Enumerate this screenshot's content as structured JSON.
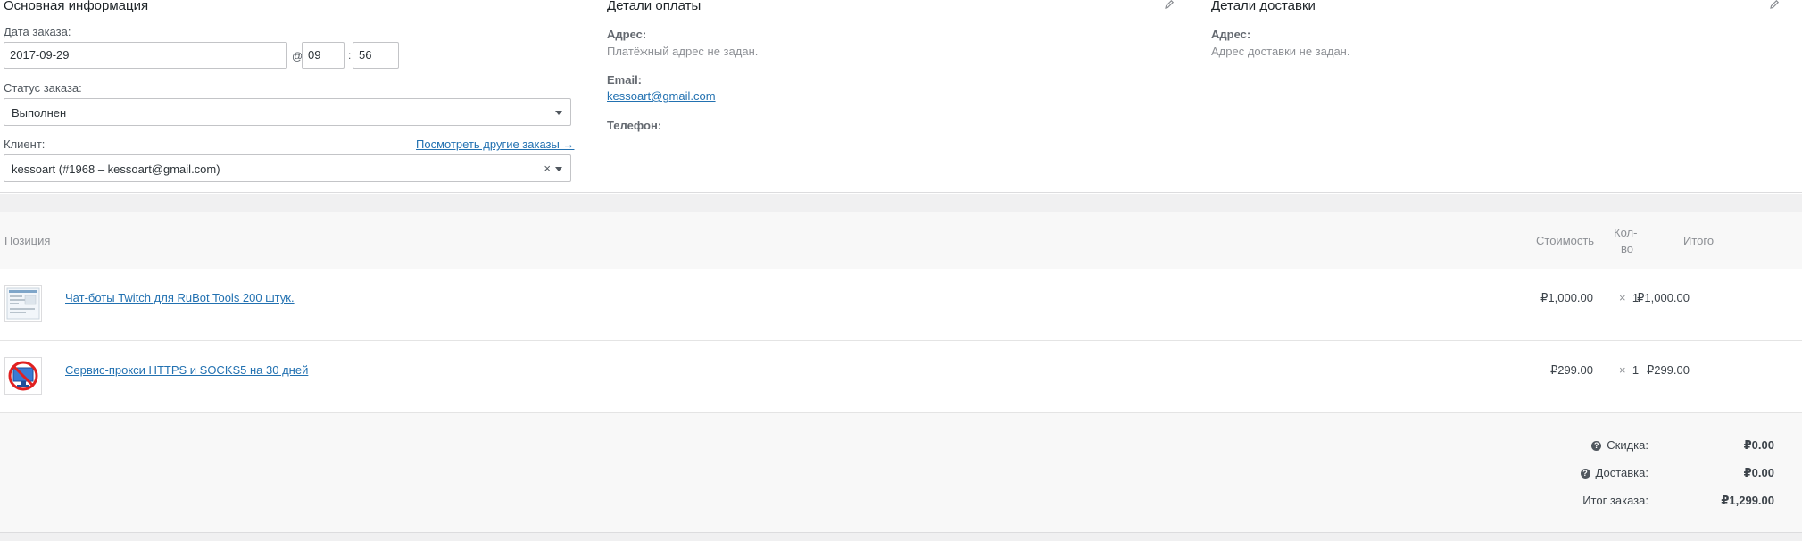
{
  "general": {
    "title": "Основная информация",
    "date_label": "Дата заказа:",
    "date_value": "2017-09-29",
    "at": "@",
    "hour": "09",
    "colon": ":",
    "minute": "56",
    "status_label": "Статус заказа:",
    "status_value": "Выполнен",
    "customer_label": "Клиент:",
    "other_orders_link": "Посмотреть другие заказы →",
    "customer_value": "kessoart (#1968 – kessoart@gmail.com)",
    "clear_icon": "×"
  },
  "billing": {
    "title": "Детали оплаты",
    "address_label": "Адрес:",
    "address_value": "Платёжный адрес не задан.",
    "email_label": "Email:",
    "email_value": "kessoart@gmail.com",
    "phone_label": "Телефон:"
  },
  "shipping": {
    "title": "Детали доставки",
    "address_label": "Адрес:",
    "address_value": "Адрес доставки не задан."
  },
  "table": {
    "col_item": "Позиция",
    "col_cost": "Стоимость",
    "col_qty_1": "Кол-",
    "col_qty_2": "во",
    "col_total": "Итого",
    "rows": [
      {
        "name": "Чат-боты Twitch для RuBot Tools 200 штук.",
        "cost": "₽1,000.00",
        "times": "×",
        "qty": "1",
        "total": "₽1,000.00",
        "thumb": "screenshot-thumbnail"
      },
      {
        "name": "Сервис-прокси HTTPS и SOCKS5 на 30 дней",
        "cost": "₽299.00",
        "times": "×",
        "qty": "1",
        "total": "₽299.00",
        "thumb": "no-monitor-icon"
      }
    ]
  },
  "totals": {
    "discount_label": "Скидка:",
    "discount_value": "₽0.00",
    "shipping_label": "Доставка:",
    "shipping_value": "₽0.00",
    "order_total_label": "Итог заказа:",
    "order_total_value": "₽1,299.00",
    "help_icon": "?"
  },
  "colors": {
    "link": "#2271b1",
    "border": "#c3c4c7",
    "muted": "#8c8f94",
    "panel": "#f8f8f8"
  }
}
